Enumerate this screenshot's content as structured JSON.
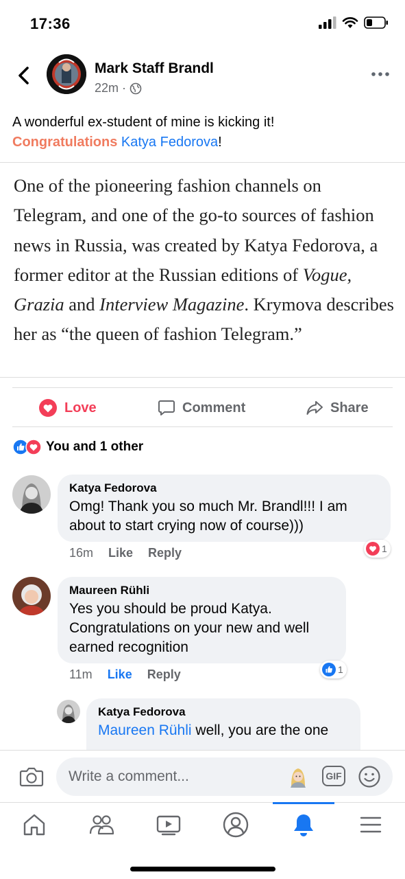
{
  "status_bar": {
    "time": "17:36"
  },
  "post": {
    "author": "Mark Staff Brandl",
    "time": "22m",
    "text_line1": "A wonderful ex-student of mine is kicking it!",
    "highlight": "Congratulations",
    "mention": "Katya Fedorova",
    "punct": "!",
    "avatar_badge_top": "ANTI-FASCIST",
    "avatar_badge_bottom": "ANTI-RACIST"
  },
  "quote": {
    "part1": "One of the pioneering fashion channels on Telegram, and one of the go-to sources of fashion news in Russia, was created by Katya Fedorova, a former editor at the Russian editions of ",
    "italic1": "Vogue, Grazia",
    "part2": " and ",
    "italic2": "Interview Magazine",
    "part3": ". Krymova describes her as “the queen of fashion Telegram.”"
  },
  "actions": {
    "love": "Love",
    "comment": "Comment",
    "share": "Share"
  },
  "reactions_summary": "You and 1 other",
  "comments": [
    {
      "name": "Katya Fedorova",
      "text": "Omg! Thank you so much  Mr. Brandl!!! I am about to start crying now of course)))",
      "time": "16m",
      "like": "Like",
      "reply": "Reply",
      "reaction_count": "1"
    },
    {
      "name": "Maureen Rühli",
      "text": "Yes you should be proud Katya. Congratulations on your new and well earned recognition",
      "time": "11m",
      "like": "Like",
      "reply": "Reply",
      "reaction_count": "1"
    }
  ],
  "reply": {
    "name": "Katya Fedorova",
    "mention": "Maureen Rühli",
    "text": " well, you are the one"
  },
  "composer": {
    "placeholder": "Write a comment...",
    "gif": "GIF"
  },
  "colors": {
    "accent": "#1877f2",
    "love": "#f33e58",
    "highlight": "#f07b5f",
    "secondary_text": "#65676b",
    "bubble": "#f0f2f5"
  },
  "icons": [
    "back-icon",
    "globe-icon",
    "more-icon",
    "heart-icon",
    "comment-icon",
    "share-icon",
    "like-icon",
    "camera-icon",
    "gif-icon",
    "emoji-icon",
    "home-icon",
    "friends-icon",
    "video-icon",
    "profile-icon",
    "bell-icon",
    "menu-icon"
  ]
}
